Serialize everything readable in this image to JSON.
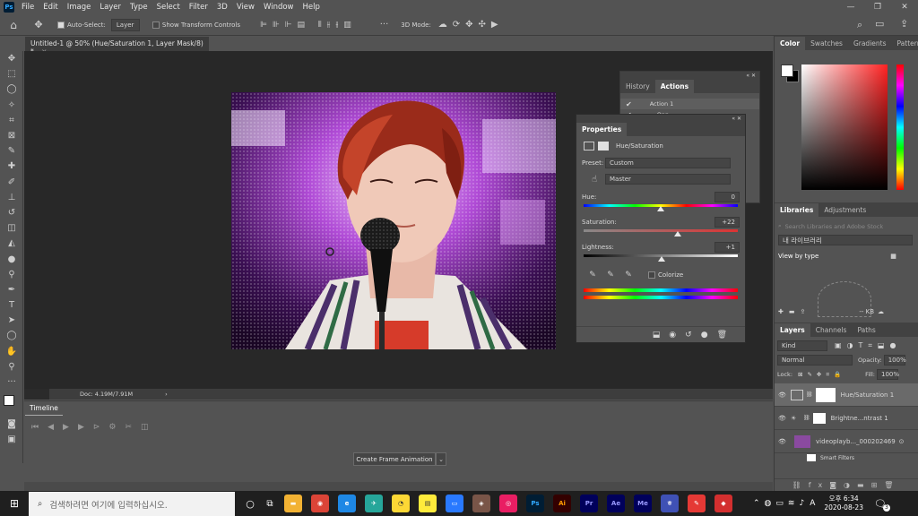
{
  "app": {
    "logo": "Ps"
  },
  "menu": [
    "File",
    "Edit",
    "Image",
    "Layer",
    "Type",
    "Select",
    "Filter",
    "3D",
    "View",
    "Window",
    "Help"
  ],
  "window_controls": [
    "—",
    "❐",
    "✕"
  ],
  "options": {
    "auto_select_label": "Auto-Select:",
    "auto_select_value": "Layer",
    "transform_label": "Show Transform Controls",
    "mode_3d_label": "3D Mode:"
  },
  "document": {
    "tab_title": "Untitled-1 @ 50% (Hue/Saturation 1, Layer Mask/8) *",
    "close": "×"
  },
  "status": {
    "doc_info": "Doc: 4.19M/7.91M",
    "arrow": "›"
  },
  "timeline": {
    "tab": "Timeline",
    "create_button": "Create Frame Animation"
  },
  "history_panel": {
    "tabs": [
      "History",
      "Actions"
    ],
    "active_tab": "Actions",
    "items": [
      "Action 1",
      "Opp"
    ]
  },
  "properties": {
    "title": "Properties",
    "adjustment": "Hue/Saturation",
    "preset_label": "Preset:",
    "preset_value": "Custom",
    "channel_value": "Master",
    "hue_label": "Hue:",
    "hue_value": "0",
    "hue_level": 0,
    "saturation_label": "Saturation:",
    "saturation_value": "+22",
    "saturation_level": 22,
    "lightness_label": "Lightness:",
    "lightness_value": "+1",
    "lightness_level": 1,
    "colorize_label": "Colorize"
  },
  "color_panel": {
    "tabs": [
      "Color",
      "Swatches",
      "Gradients",
      "Patterns"
    ],
    "active_tab": "Color",
    "hue_color": "#ff2020"
  },
  "libraries": {
    "tabs": [
      "Libraries",
      "Adjustments"
    ],
    "active_tab": "Libraries",
    "search_placeholder": "Search Libraries and Adobe Stock",
    "library_name": "내 라이브러리",
    "view_by": "View by type",
    "storage": "-- KB"
  },
  "layers": {
    "tabs": [
      "Layers",
      "Channels",
      "Paths"
    ],
    "active_tab": "Layers",
    "kind": "Kind",
    "blend_mode": "Normal",
    "opacity_label": "Opacity:",
    "opacity_value": "100%",
    "lock_label": "Lock:",
    "fill_label": "Fill:",
    "fill_value": "100%",
    "items": [
      {
        "name": "Hue/Saturation 1",
        "selected": true
      },
      {
        "name": "Brightne...ntrast 1",
        "selected": false
      },
      {
        "name": "videoplayb..._000202469",
        "selected": false
      },
      {
        "name": "Smart Filters",
        "selected": false
      }
    ]
  },
  "taskbar": {
    "search_placeholder": "검색하려면 여기에 입력하십시오.",
    "ime": "A",
    "time": "오후 6:34",
    "date": "2020-08-23",
    "notification_count": "3",
    "apps": [
      {
        "name": "Ps",
        "color": "#001d34",
        "text_color": "#31a8ff"
      },
      {
        "name": "Ai",
        "color": "#330000",
        "text_color": "#ff9a00"
      },
      {
        "name": "Pr",
        "color": "#00005b",
        "text_color": "#9999ff"
      },
      {
        "name": "Ae",
        "color": "#00005b",
        "text_color": "#9999ff"
      },
      {
        "name": "Me",
        "color": "#00005b",
        "text_color": "#9999ff"
      }
    ]
  }
}
